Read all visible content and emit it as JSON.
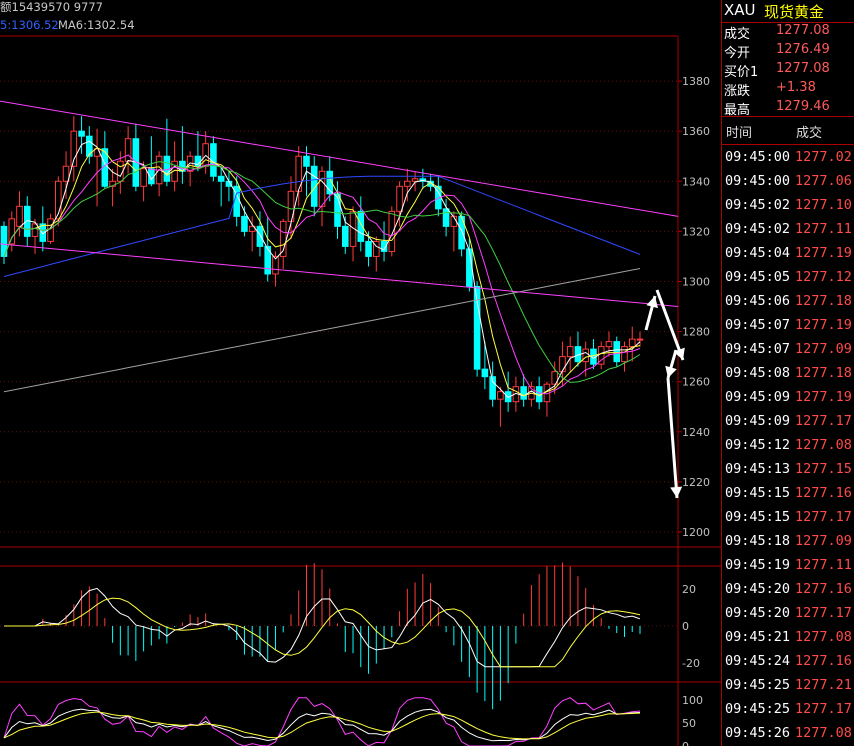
{
  "header": {
    "line1": "额15439570 9777",
    "ma5_label": "5:1306.52",
    "ma6_label": "MA6:1302.54",
    "colors": {
      "text": "#c8c8c8",
      "ma5": "#3060ff",
      "ma6": "#c8c8c8"
    }
  },
  "quote_panel": {
    "symbol": "XAU",
    "name": "现货黄金",
    "fields": [
      {
        "label": "成交",
        "value": "1277.08"
      },
      {
        "label": "今开",
        "value": "1276.49"
      },
      {
        "label": "买价1",
        "value": "1277.08"
      },
      {
        "label": "涨跌",
        "value": "+1.38"
      },
      {
        "label": "最高",
        "value": "1279.46"
      }
    ],
    "ticks_header": {
      "time": "时间",
      "price": "成交"
    },
    "ticks": [
      {
        "time": "09:45:00",
        "price": "1277.02"
      },
      {
        "time": "09:45:00",
        "price": "1277.06"
      },
      {
        "time": "09:45:02",
        "price": "1277.10"
      },
      {
        "time": "09:45:02",
        "price": "1277.11"
      },
      {
        "time": "09:45:04",
        "price": "1277.19"
      },
      {
        "time": "09:45:05",
        "price": "1277.12"
      },
      {
        "time": "09:45:06",
        "price": "1277.18"
      },
      {
        "time": "09:45:07",
        "price": "1277.19"
      },
      {
        "time": "09:45:07",
        "price": "1277.09"
      },
      {
        "time": "09:45:08",
        "price": "1277.18"
      },
      {
        "time": "09:45:09",
        "price": "1277.19"
      },
      {
        "time": "09:45:09",
        "price": "1277.17"
      },
      {
        "time": "09:45:12",
        "price": "1277.08"
      },
      {
        "time": "09:45:13",
        "price": "1277.15"
      },
      {
        "time": "09:45:15",
        "price": "1277.16"
      },
      {
        "time": "09:45:15",
        "price": "1277.17"
      },
      {
        "time": "09:45:18",
        "price": "1277.09"
      },
      {
        "time": "09:45:19",
        "price": "1277.11"
      },
      {
        "time": "09:45:20",
        "price": "1277.16"
      },
      {
        "time": "09:45:20",
        "price": "1277.17"
      },
      {
        "time": "09:45:21",
        "price": "1277.08"
      },
      {
        "time": "09:45:24",
        "price": "1277.16"
      },
      {
        "time": "09:45:25",
        "price": "1277.21"
      },
      {
        "time": "09:45:25",
        "price": "1277.17"
      },
      {
        "time": "09:45:26",
        "price": "1277.08"
      }
    ]
  },
  "chart_data": [
    {
      "type": "candlestick",
      "panel": "price",
      "ylim": [
        1194,
        1398
      ],
      "y_ticks": [
        1380,
        1360,
        1340,
        1320,
        1300,
        1280,
        1260,
        1240,
        1220,
        1200
      ],
      "colors": {
        "up": "#ff3c3c",
        "down": "#00ffff",
        "ma_fast": "#ffffff",
        "ma_yellow": "#ffff40",
        "ma_magenta": "#ff40ff",
        "ma_green": "#40d040",
        "ma_blue": "#3048ff",
        "ma_gray": "#a0a0a0",
        "channel": "#ff40ff"
      },
      "candles": [
        [
          1322,
          1324,
          1307,
          1310
        ],
        [
          1315,
          1328,
          1312,
          1325
        ],
        [
          1322,
          1336,
          1318,
          1330
        ],
        [
          1330,
          1334,
          1314,
          1318
        ],
        [
          1318,
          1325,
          1311,
          1323
        ],
        [
          1323,
          1330,
          1312,
          1316
        ],
        [
          1316,
          1327,
          1315,
          1325
        ],
        [
          1325,
          1342,
          1322,
          1340
        ],
        [
          1340,
          1352,
          1333,
          1346
        ],
        [
          1346,
          1366,
          1340,
          1360
        ],
        [
          1360,
          1366,
          1351,
          1358
        ],
        [
          1358,
          1362,
          1347,
          1350
        ],
        [
          1350,
          1361,
          1330,
          1353
        ],
        [
          1353,
          1360,
          1337,
          1338
        ],
        [
          1338,
          1345,
          1330,
          1340
        ],
        [
          1340,
          1352,
          1335,
          1348
        ],
        [
          1348,
          1362,
          1343,
          1357
        ],
        [
          1357,
          1363,
          1336,
          1338
        ],
        [
          1338,
          1348,
          1332,
          1345
        ],
        [
          1345,
          1358,
          1338,
          1339
        ],
        [
          1339,
          1352,
          1334,
          1350
        ],
        [
          1350,
          1365,
          1338,
          1340
        ],
        [
          1340,
          1356,
          1336,
          1348
        ],
        [
          1348,
          1362,
          1339,
          1344
        ],
        [
          1344,
          1352,
          1338,
          1350
        ],
        [
          1350,
          1360,
          1344,
          1346
        ],
        [
          1346,
          1360,
          1343,
          1355
        ],
        [
          1355,
          1358,
          1340,
          1342
        ],
        [
          1342,
          1346,
          1330,
          1340
        ],
        [
          1340,
          1344,
          1332,
          1338
        ],
        [
          1338,
          1342,
          1322,
          1326
        ],
        [
          1326,
          1330,
          1318,
          1320
        ],
        [
          1320,
          1326,
          1312,
          1322
        ],
        [
          1322,
          1328,
          1310,
          1314
        ],
        [
          1314,
          1326,
          1300,
          1303
        ],
        [
          1303,
          1312,
          1298,
          1310
        ],
        [
          1310,
          1325,
          1305,
          1324
        ],
        [
          1324,
          1342,
          1317,
          1336
        ],
        [
          1336,
          1354,
          1330,
          1350
        ],
        [
          1350,
          1354,
          1334,
          1346
        ],
        [
          1346,
          1350,
          1326,
          1330
        ],
        [
          1330,
          1346,
          1322,
          1344
        ],
        [
          1344,
          1350,
          1332,
          1335
        ],
        [
          1335,
          1340,
          1317,
          1322
        ],
        [
          1322,
          1326,
          1311,
          1314
        ],
        [
          1314,
          1330,
          1308,
          1328
        ],
        [
          1328,
          1334,
          1312,
          1316
        ],
        [
          1316,
          1320,
          1306,
          1310
        ],
        [
          1310,
          1318,
          1304,
          1316
        ],
        [
          1316,
          1324,
          1308,
          1312
        ],
        [
          1312,
          1330,
          1310,
          1328
        ],
        [
          1328,
          1340,
          1322,
          1338
        ],
        [
          1338,
          1345,
          1332,
          1340
        ],
        [
          1340,
          1344,
          1336,
          1341
        ],
        [
          1341,
          1345,
          1337,
          1340
        ],
        [
          1340,
          1343,
          1336,
          1338
        ],
        [
          1338,
          1342,
          1326,
          1329
        ],
        [
          1329,
          1333,
          1318,
          1322
        ],
        [
          1322,
          1328,
          1312,
          1326
        ],
        [
          1326,
          1328,
          1310,
          1313
        ],
        [
          1313,
          1317,
          1296,
          1298
        ],
        [
          1298,
          1300,
          1262,
          1265
        ],
        [
          1265,
          1276,
          1257,
          1262
        ],
        [
          1262,
          1268,
          1250,
          1253
        ],
        [
          1253,
          1258,
          1242,
          1256
        ],
        [
          1256,
          1264,
          1248,
          1252
        ],
        [
          1252,
          1262,
          1248,
          1258
        ],
        [
          1258,
          1263,
          1250,
          1253
        ],
        [
          1253,
          1260,
          1250,
          1258
        ],
        [
          1258,
          1262,
          1249,
          1252
        ],
        [
          1252,
          1260,
          1246,
          1259
        ],
        [
          1259,
          1268,
          1255,
          1264
        ],
        [
          1264,
          1276,
          1258,
          1270
        ],
        [
          1270,
          1278,
          1264,
          1274
        ],
        [
          1274,
          1280,
          1266,
          1268
        ],
        [
          1268,
          1276,
          1262,
          1273
        ],
        [
          1273,
          1277,
          1265,
          1267
        ],
        [
          1267,
          1276,
          1265,
          1274
        ],
        [
          1274,
          1280,
          1270,
          1276
        ],
        [
          1276,
          1278,
          1266,
          1268
        ],
        [
          1268,
          1276,
          1264,
          1274
        ],
        [
          1274,
          1282,
          1268,
          1277
        ],
        [
          1277,
          1280,
          1274,
          1277
        ]
      ],
      "channel_upper": [
        [
          1372,
          1399
        ],
        [
          1326,
          1342
        ]
      ],
      "channel_lower": [
        [
          1315,
          1311
        ],
        [
          1290,
          1288
        ]
      ],
      "annotation_arrows": [
        {
          "from": [
            1269.5,
            1282
          ],
          "to": [
            1274,
            1290
          ]
        },
        {
          "from": [
            1275,
            1290
          ],
          "to": [
            1281,
            1264
          ]
        },
        {
          "from": [
            1280,
            1268
          ],
          "to": [
            1276,
            1258
          ]
        },
        {
          "from": [
            1276,
            1258
          ],
          "to": [
            1277,
            1202
          ]
        }
      ]
    },
    {
      "type": "line+bar",
      "panel": "macd",
      "ylim": [
        -20,
        20
      ],
      "y_ticks": [
        20,
        0,
        -20
      ]
    },
    {
      "type": "line",
      "panel": "kdj",
      "ylim": [
        0,
        100
      ],
      "y_ticks": [
        100,
        50,
        0
      ]
    }
  ]
}
